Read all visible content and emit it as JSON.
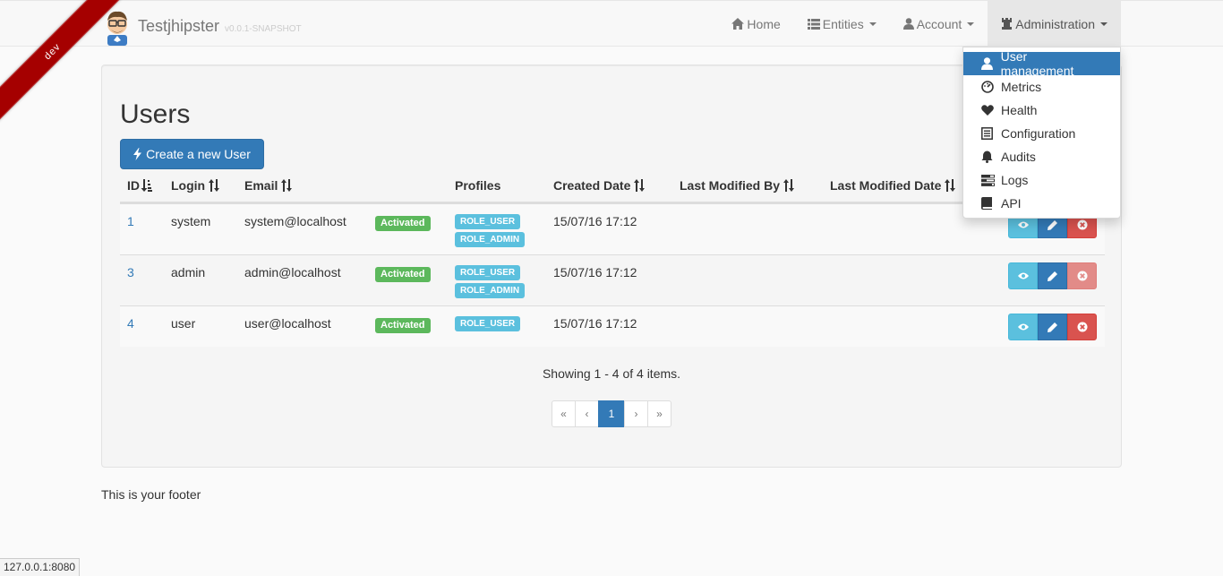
{
  "ribbon": {
    "label": "dev"
  },
  "brand": {
    "name": "Testjhipster",
    "version": "v0.0.1-SNAPSHOT"
  },
  "nav": {
    "home": "Home",
    "entities": "Entities",
    "account": "Account",
    "administration": "Administration"
  },
  "admin_menu": [
    {
      "label": "User management",
      "icon": "user-icon",
      "active": true
    },
    {
      "label": "Metrics",
      "icon": "dashboard-icon"
    },
    {
      "label": "Health",
      "icon": "heart-icon"
    },
    {
      "label": "Configuration",
      "icon": "list-alt-icon"
    },
    {
      "label": "Audits",
      "icon": "bell-icon"
    },
    {
      "label": "Logs",
      "icon": "tasks-icon"
    },
    {
      "label": "API",
      "icon": "book-icon"
    }
  ],
  "page": {
    "title": "Users",
    "create_button": "Create a new User"
  },
  "table": {
    "headers": {
      "id": "ID",
      "login": "Login",
      "email": "Email",
      "profiles": "Profiles",
      "created_date": "Created Date",
      "last_modified_by": "Last Modified By",
      "last_modified_date": "Last Modified Date"
    },
    "rows": [
      {
        "id": "1",
        "login": "system",
        "email": "system@localhost",
        "status": "Activated",
        "roles": [
          "ROLE_USER",
          "ROLE_ADMIN"
        ],
        "created": "15/07/16 17:12",
        "delete_disabled": false
      },
      {
        "id": "3",
        "login": "admin",
        "email": "admin@localhost",
        "status": "Activated",
        "roles": [
          "ROLE_USER",
          "ROLE_ADMIN"
        ],
        "created": "15/07/16 17:12",
        "delete_disabled": true
      },
      {
        "id": "4",
        "login": "user",
        "email": "user@localhost",
        "status": "Activated",
        "roles": [
          "ROLE_USER"
        ],
        "created": "15/07/16 17:12",
        "delete_disabled": false
      }
    ]
  },
  "pagination": {
    "summary": "Showing 1 - 4 of 4 items.",
    "first": "«",
    "prev": "‹",
    "current": "1",
    "next": "›",
    "last": "»"
  },
  "footer": {
    "text": "This is your footer"
  },
  "status_bar": {
    "url": "127.0.0.1:8080"
  },
  "colors": {
    "primary": "#337ab7",
    "success": "#5cb85c",
    "info": "#5bc0de",
    "danger": "#d9534f",
    "ribbon": "#a50000"
  }
}
